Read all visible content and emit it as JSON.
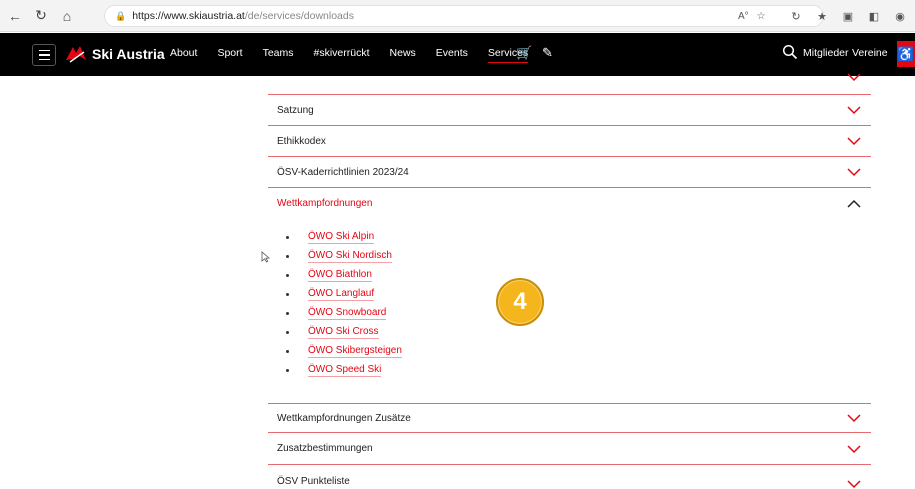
{
  "browser": {
    "url_host": "https://www.skiaustria.at",
    "url_path": "/de/services/downloads"
  },
  "header": {
    "brand": "Ski Austria",
    "nav": [
      "About",
      "Sport",
      "Teams",
      "#skiverrückt",
      "News",
      "Events",
      "Services"
    ],
    "active_nav": "Services",
    "members_label": "Mitglieder",
    "clubs_label": "Vereine"
  },
  "accordion": {
    "rows": [
      {
        "label": "Satzung",
        "open": false
      },
      {
        "label": "Ethikkodex",
        "open": false
      },
      {
        "label": "ÖSV-Kaderrichtlinien 2023/24",
        "open": false
      },
      {
        "label": "Wettkampfordnungen",
        "open": true
      },
      {
        "label": "Wettkampfordnungen Zusätze",
        "open": false
      },
      {
        "label": "Zusatzbestimmungen",
        "open": false
      },
      {
        "label": "ÖSV Punkteliste",
        "open": false
      }
    ],
    "sublinks": [
      "ÖWO Ski Alpin",
      "ÖWO Ski Nordisch",
      "ÖWO Biathlon",
      "ÖWO Langlauf",
      "ÖWO Snowboard",
      "ÖWO Ski Cross",
      "ÖWO Skibergsteigen",
      "ÖWO Speed Ski"
    ]
  },
  "badge": {
    "number": "4"
  },
  "colors": {
    "accent": "#e30613",
    "header_bg": "#000000",
    "badge": "#f4b61c"
  }
}
